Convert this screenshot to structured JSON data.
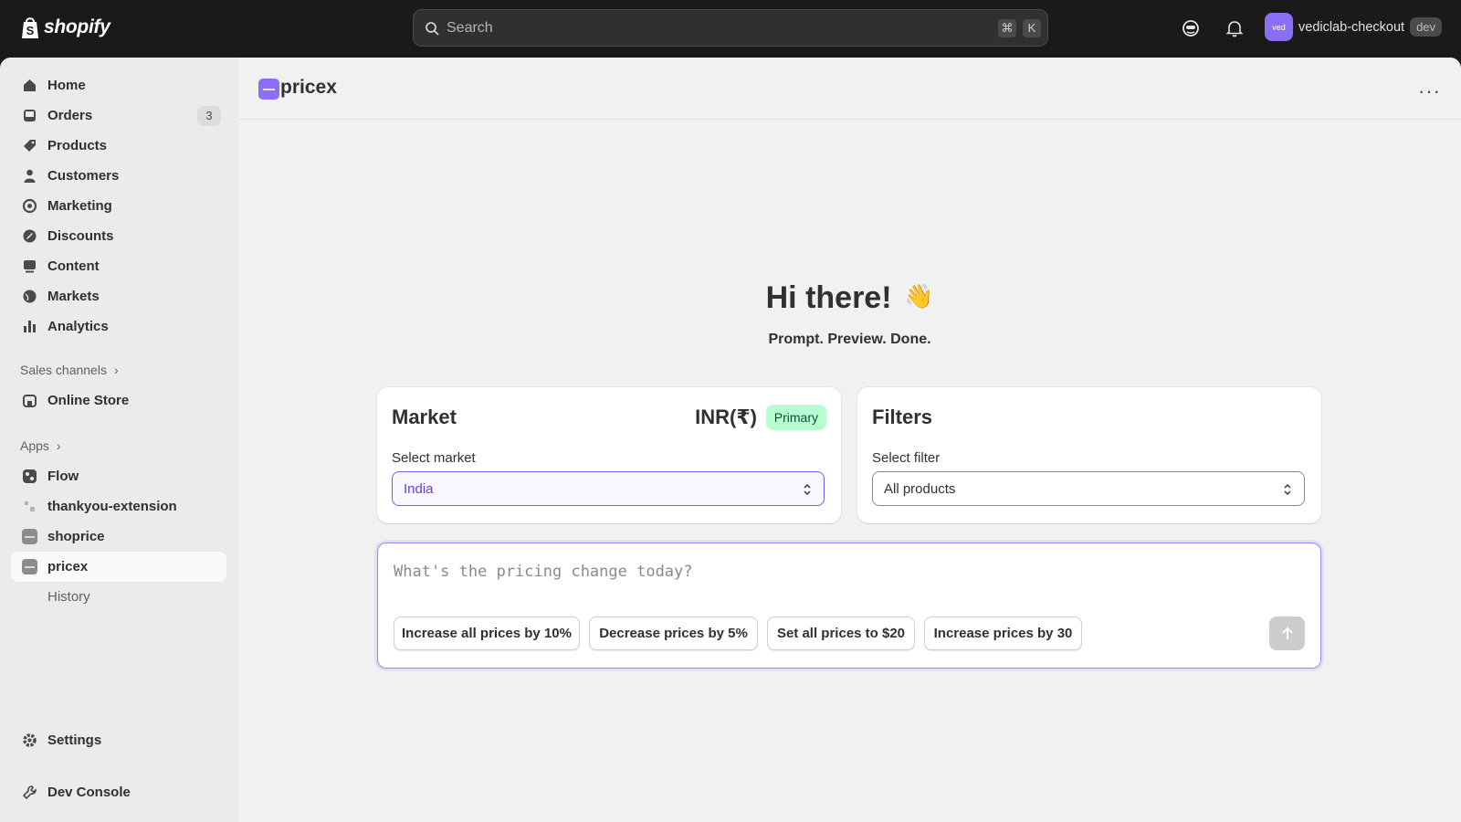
{
  "brand": {
    "name": "shopify"
  },
  "search": {
    "placeholder": "Search",
    "shortcut_mod": "⌘",
    "shortcut_key": "K"
  },
  "topbar": {
    "store_name": "vediclab-checkout",
    "store_initials": "ved",
    "store_badge": "dev"
  },
  "sidebar": {
    "items": [
      {
        "label": "Home",
        "icon": "home-icon"
      },
      {
        "label": "Orders",
        "icon": "inbox-icon",
        "count": "3"
      },
      {
        "label": "Products",
        "icon": "tag-icon"
      },
      {
        "label": "Customers",
        "icon": "person-icon"
      },
      {
        "label": "Marketing",
        "icon": "target-icon"
      },
      {
        "label": "Discounts",
        "icon": "discount-icon"
      },
      {
        "label": "Content",
        "icon": "content-icon"
      },
      {
        "label": "Markets",
        "icon": "globe-icon"
      },
      {
        "label": "Analytics",
        "icon": "bar-chart-icon"
      }
    ],
    "sales_channels_heading": "Sales channels",
    "online_store": "Online Store",
    "apps_heading": "Apps",
    "apps": [
      {
        "label": "Flow"
      },
      {
        "label": "thankyou-extension"
      },
      {
        "label": "shoprice"
      },
      {
        "label": "pricex"
      }
    ],
    "history": "History",
    "settings": "Settings",
    "dev_console": "Dev Console"
  },
  "page": {
    "app_title": "pricex",
    "more": "···"
  },
  "hero": {
    "title": "Hi there!",
    "emoji": "👋",
    "subtitle": "Prompt. Preview. Done."
  },
  "market_card": {
    "title": "Market",
    "currency": "INR(₹)",
    "badge": "Primary",
    "field_label": "Select market",
    "value": "India"
  },
  "filters_card": {
    "title": "Filters",
    "field_label": "Select filter",
    "value": "All products"
  },
  "prompt": {
    "placeholder": "What's the pricing change today?",
    "chips": [
      "Increase all prices by 10%",
      "Decrease prices by 5%",
      "Set all prices to $20",
      "Increase prices by 30"
    ]
  },
  "colors": {
    "accent": "#8a6ef5",
    "badge_bg": "#b4fed2",
    "topbar": "#1a1a1a"
  }
}
